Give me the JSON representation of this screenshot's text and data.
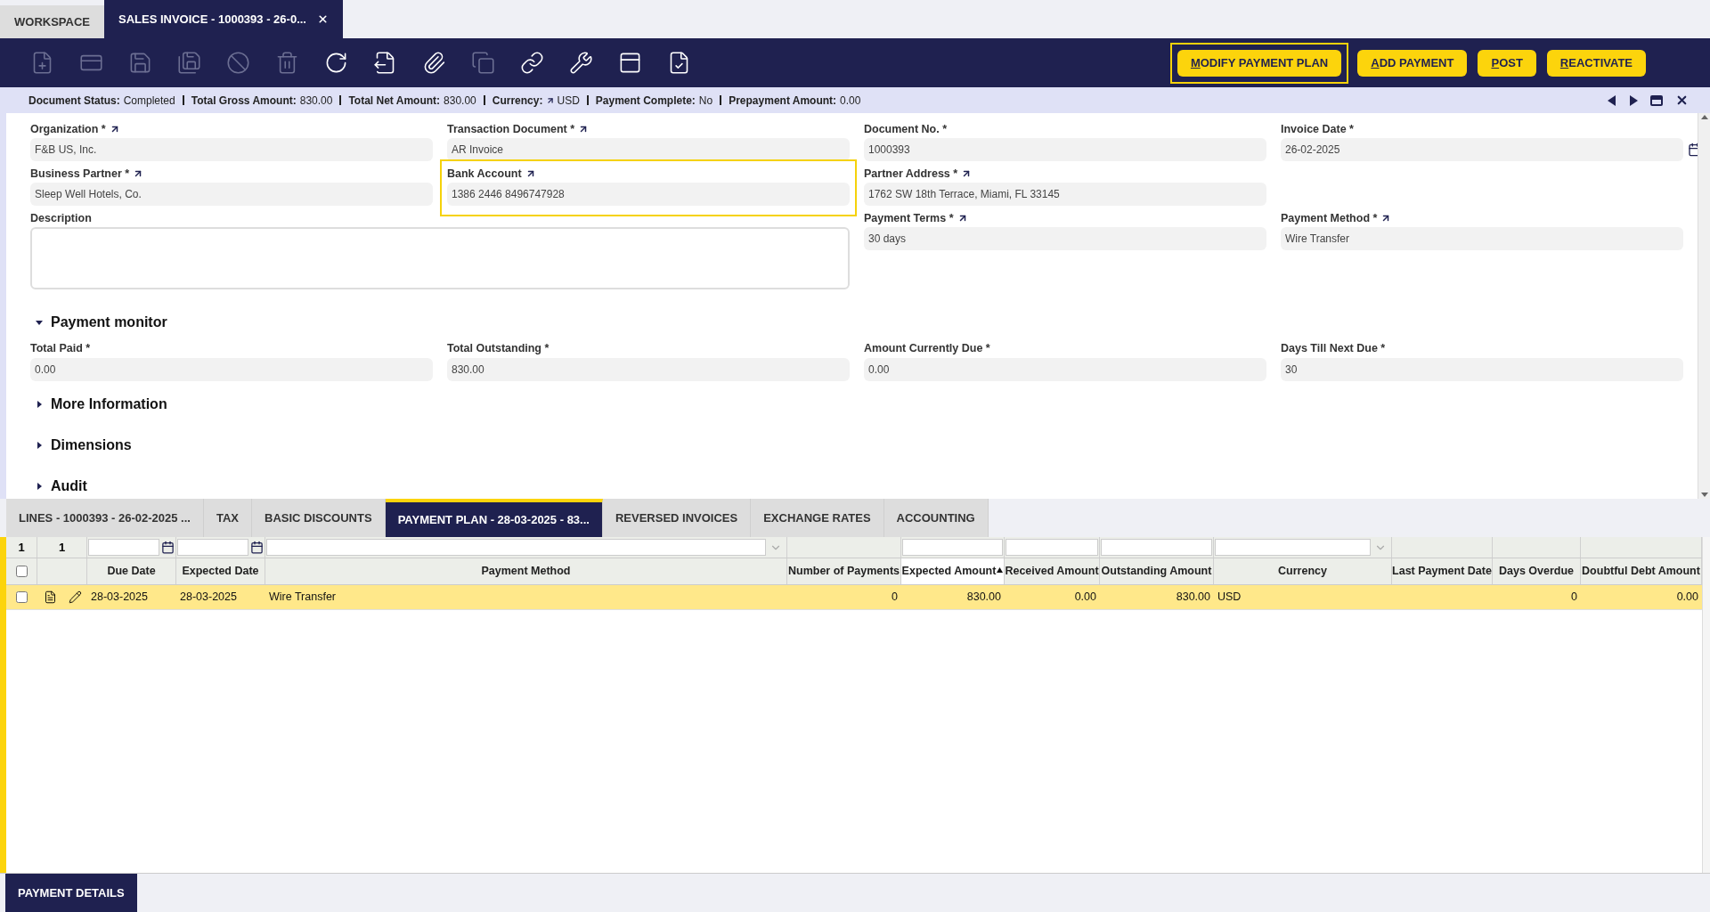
{
  "tabs": [
    {
      "label": "WORKSPACE",
      "selected": false,
      "closable": false
    },
    {
      "label": "SALES INVOICE - 1000393 - 26-0...",
      "selected": true,
      "closable": true
    }
  ],
  "toolbar": {
    "icons": [
      {
        "disabled": true
      },
      {
        "disabled": true
      },
      {
        "disabled": true
      },
      {
        "disabled": true
      },
      {
        "disabled": true
      },
      {
        "disabled": true
      },
      {
        "disabled": false
      },
      {
        "disabled": false
      },
      {
        "disabled": false
      },
      {
        "disabled": true
      },
      {
        "disabled": false
      },
      {
        "disabled": false
      },
      {
        "disabled": false
      },
      {
        "disabled": false
      }
    ],
    "buttons": [
      {
        "label": "MODIFY PAYMENT PLAN",
        "focused": true
      },
      {
        "label": "ADD PAYMENT",
        "focused": false
      },
      {
        "label": "POST",
        "focused": false
      },
      {
        "label": "REACTIVATE",
        "focused": false
      }
    ]
  },
  "status_bar": [
    {
      "label": "Document Status:",
      "value": "Completed",
      "link": false
    },
    {
      "label": "Total Gross Amount:",
      "value": "830.00",
      "link": false
    },
    {
      "label": "Total Net Amount:",
      "value": "830.00",
      "link": false
    },
    {
      "label": "Currency:",
      "value": "USD",
      "link": true
    },
    {
      "label": "Payment Complete:",
      "value": "No",
      "link": false
    },
    {
      "label": "Prepayment Amount:",
      "value": "0.00",
      "link": false
    }
  ],
  "form": {
    "fields": [
      {
        "label": "Organization *",
        "value": "F&B US, Inc.",
        "kind": "text",
        "link": true,
        "focused": false
      },
      {
        "label": "Transaction Document *",
        "value": "AR Invoice",
        "kind": "text",
        "link": true,
        "focused": false
      },
      {
        "label": "Document No. *",
        "value": "1000393",
        "kind": "text",
        "link": false,
        "focused": false
      },
      {
        "label": "Invoice Date *",
        "value": "26-02-2025",
        "kind": "date",
        "link": false,
        "focused": false
      },
      {
        "label": "Business Partner *",
        "value": "Sleep Well Hotels, Co.",
        "kind": "text",
        "link": true,
        "focused": false
      },
      {
        "label": "Bank Account",
        "value": "1386 2446 8496747928",
        "kind": "text",
        "link": true,
        "focused": true
      },
      {
        "label": "Partner Address *",
        "value": "1762 SW 18th Terrace, Miami, FL 33145",
        "kind": "text",
        "link": true,
        "focused": false
      },
      {
        "kind": "blank"
      },
      {
        "label": "Description",
        "kind": "textarea",
        "link": false,
        "focused": false
      },
      {
        "label": "Payment Terms *",
        "value": "30 days",
        "kind": "text",
        "link": true,
        "focused": false
      },
      {
        "label": "Payment Method *",
        "value": "Wire Transfer",
        "kind": "text",
        "link": true,
        "focused": false
      }
    ],
    "sections": [
      {
        "title": "Payment monitor",
        "expanded": true,
        "fields": [
          {
            "label": "Total Paid *",
            "value": "0.00"
          },
          {
            "label": "Total Outstanding *",
            "value": "830.00"
          },
          {
            "label": "Amount Currently Due *",
            "value": "0.00"
          },
          {
            "label": "Days Till Next Due *",
            "value": "30"
          }
        ]
      },
      {
        "title": "More Information",
        "expanded": false
      },
      {
        "title": "Dimensions",
        "expanded": false
      },
      {
        "title": "Audit",
        "expanded": false
      }
    ]
  },
  "subtabs": [
    {
      "label": "LINES - 1000393 - 26-02-2025 ...",
      "selected": false
    },
    {
      "label": "TAX",
      "selected": false
    },
    {
      "label": "BASIC DISCOUNTS",
      "selected": false
    },
    {
      "label": "PAYMENT PLAN - 28-03-2025 - 83...",
      "selected": true
    },
    {
      "label": "REVERSED INVOICES",
      "selected": false
    },
    {
      "label": "EXCHANGE RATES",
      "selected": false
    },
    {
      "label": "ACCOUNTING",
      "selected": false
    }
  ],
  "grid": {
    "filters": [
      {
        "kind": "count",
        "text": "1"
      },
      {
        "kind": "count",
        "text": "1"
      },
      {
        "kind": "date"
      },
      {
        "kind": "date"
      },
      {
        "kind": "select"
      },
      {
        "kind": "none"
      },
      {
        "kind": "text"
      },
      {
        "kind": "text"
      },
      {
        "kind": "text"
      },
      {
        "kind": "select"
      },
      {
        "kind": "none"
      },
      {
        "kind": "none"
      },
      {
        "kind": "none"
      }
    ],
    "columns": [
      {
        "kind": "checkbox",
        "checked": false
      },
      {
        "kind": "actions"
      },
      {
        "kind": "data",
        "label": "Due Date",
        "sorted": false
      },
      {
        "kind": "data",
        "label": "Expected Date",
        "sorted": false
      },
      {
        "kind": "data",
        "label": "Payment Method",
        "sorted": false
      },
      {
        "kind": "data",
        "label": "Number of Payments",
        "sorted": false
      },
      {
        "kind": "data",
        "label": "Expected Amount",
        "sorted": true
      },
      {
        "kind": "data",
        "label": "Received Amount",
        "sorted": false
      },
      {
        "kind": "data",
        "label": "Outstanding Amount",
        "sorted": false
      },
      {
        "kind": "data",
        "label": "Currency",
        "sorted": false
      },
      {
        "kind": "data",
        "label": "Last Payment Date",
        "sorted": false
      },
      {
        "kind": "data",
        "label": "Days Overdue",
        "sorted": false
      },
      {
        "kind": "data",
        "label": "Doubtful Debt Amount",
        "sorted": false
      }
    ],
    "rows": [
      {
        "selected": true,
        "checked": false,
        "cells": [
          "",
          "",
          "28-03-2025",
          "28-03-2025",
          "Wire Transfer",
          "0",
          "830.00",
          "0.00",
          "830.00",
          "USD",
          "",
          "0",
          "0.00"
        ]
      }
    ]
  },
  "bottom_tabs": [
    {
      "label": "PAYMENT DETAILS",
      "selected": true
    }
  ]
}
